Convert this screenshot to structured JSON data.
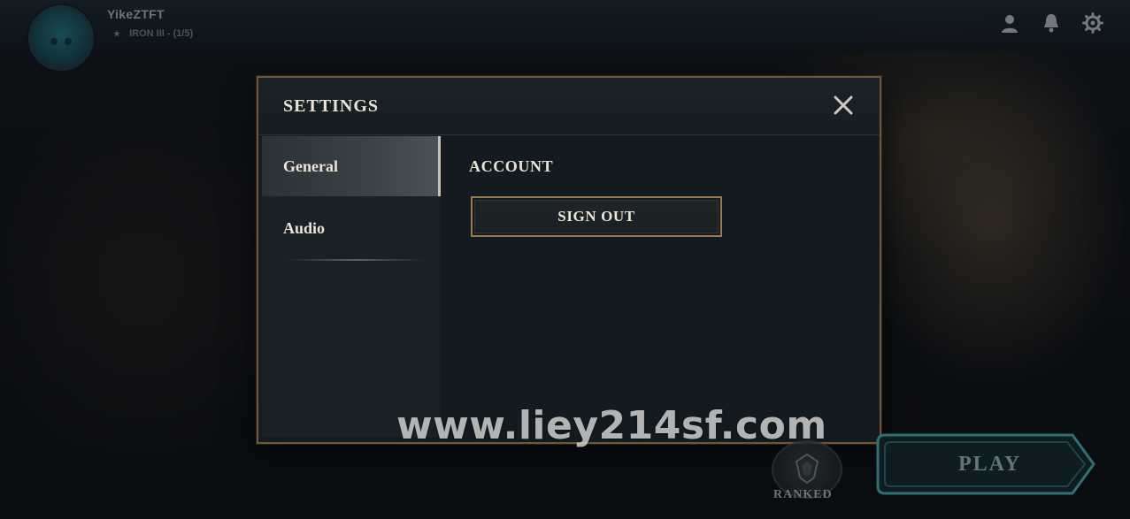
{
  "profile": {
    "username": "YikeZTFT",
    "rank": "IRON III - (1/5)",
    "star_icon": "star-icon"
  },
  "top_icons": [
    "profile-icon",
    "bell-icon",
    "gear-icon"
  ],
  "settings": {
    "title": "SETTINGS",
    "close_icon": "close-icon",
    "tabs": [
      {
        "label": "General",
        "active": true
      },
      {
        "label": "Audio",
        "active": false
      }
    ],
    "account": {
      "section_title": "ACCOUNT",
      "sign_out_label": "SIGN OUT"
    }
  },
  "ranked": {
    "label": "RANKED"
  },
  "play": {
    "label": "PLAY"
  },
  "watermark": "www.liey214sf.com",
  "colors": {
    "accent_gold": "#9a7a52",
    "text_light": "#e8e2d4",
    "panel_bg": "#141c21",
    "play_teal": "#2f6f73"
  }
}
